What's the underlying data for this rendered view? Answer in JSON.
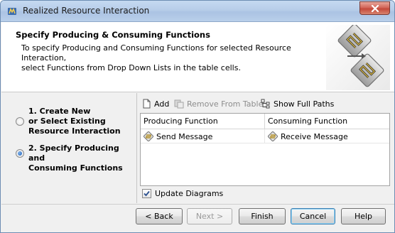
{
  "window": {
    "title": "Realized Resource Interaction"
  },
  "header": {
    "title": "Specify Producing & Consuming Functions",
    "description_line1": "To specify Producing and Consuming Functions for selected Resource Interaction,",
    "description_line2": "select Functions from Drop Down Lists in the table cells."
  },
  "steps": [
    {
      "line1": "1. Create New",
      "line2": "or Select Existing",
      "line3": "Resource Interaction",
      "selected": false
    },
    {
      "line1": "2. Specify Producing and",
      "line2": "Consuming Functions",
      "selected": true
    }
  ],
  "toolbar": {
    "add_label": "Add",
    "remove_label": "Remove From Table",
    "show_paths_label": "Show Full Paths"
  },
  "table": {
    "columns": [
      "Producing Function",
      "Consuming Function"
    ],
    "rows": [
      {
        "producing": "Send Message",
        "consuming": "Receive Message"
      }
    ]
  },
  "options": {
    "update_diagrams_label": "Update Diagrams",
    "update_diagrams_checked": true
  },
  "buttons": {
    "back": "< Back",
    "next": "Next >",
    "finish": "Finish",
    "cancel": "Cancel",
    "help": "Help"
  },
  "colors": {
    "title_bar": "#b7cde9",
    "close_button": "#c44a3b",
    "accent_blue": "#1f5fb8"
  }
}
